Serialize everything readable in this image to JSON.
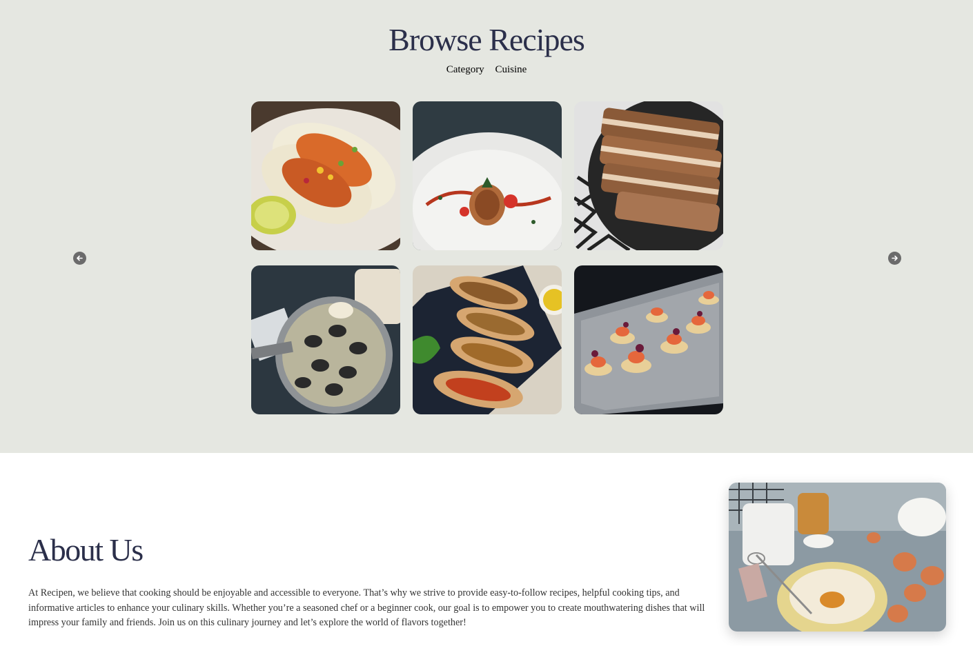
{
  "browse": {
    "title": "Browse Recipes",
    "filters": [
      "Category",
      "Cuisine"
    ],
    "prev_icon": "arrow-left-icon",
    "next_icon": "arrow-right-icon"
  },
  "recipes": [
    {
      "name": "recipe-tacos",
      "alt": "tacos"
    },
    {
      "name": "recipe-spaghetti",
      "alt": "spaghetti"
    },
    {
      "name": "recipe-pork-belly",
      "alt": "pork belly"
    },
    {
      "name": "recipe-clams",
      "alt": "clams"
    },
    {
      "name": "recipe-bruschetta",
      "alt": "bruschetta"
    },
    {
      "name": "recipe-canapes",
      "alt": "canapes"
    }
  ],
  "about": {
    "title": "About Us",
    "text": "At Recipen, we believe that cooking should be enjoyable and accessible to everyone. That’s why we strive to provide easy-to-follow recipes, helpful cooking tips, and informative articles to enhance your culinary skills. Whether you’re a seasoned chef or a beginner cook, our goal is to empower you to create mouthwatering dishes that will impress your family and friends. Join us on this culinary journey and let’s explore the world of flavors together!"
  },
  "colors": {
    "section_bg": "#e5e7e1",
    "heading": "#2b2f4a",
    "nav_button": "#6b6b6b"
  }
}
